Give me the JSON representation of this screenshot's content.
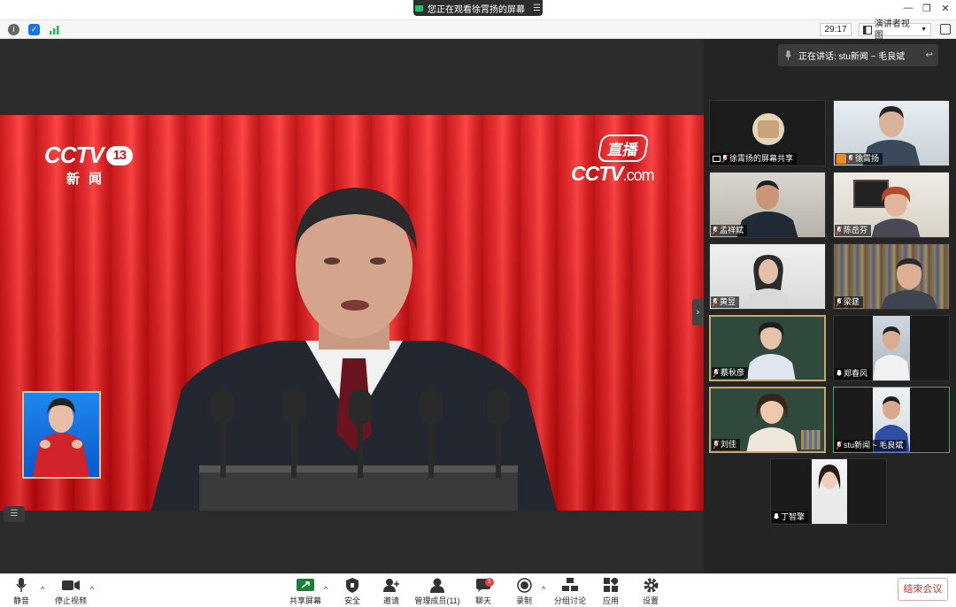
{
  "share_banner": {
    "text": "您正在观看徐霄扬的屏幕",
    "menu_icon": "menu-icon"
  },
  "toolbar": {
    "timer": "29:17",
    "view_label": "演讲者视图"
  },
  "video": {
    "channel_logo": "CCTV",
    "channel_number": "13",
    "channel_name": "新闻",
    "live_label": "直播",
    "live_logo": "CCTV",
    "live_logo_suffix": ".com"
  },
  "panel": {
    "talking_label": "正在讲话: stu新闻 ~ 毛良斌",
    "tiles": [
      {
        "name": "徐霄扬的屏幕共享"
      },
      {
        "name": "徐霄扬"
      },
      {
        "name": "孟祥斌"
      },
      {
        "name": "陈岳芬"
      },
      {
        "name": "黄昱"
      },
      {
        "name": "梁莛"
      },
      {
        "name": "蔡秋彦"
      },
      {
        "name": "郑春风"
      },
      {
        "name": "刘佳"
      },
      {
        "name": "stu新闻 ~ 毛良斌"
      },
      {
        "name": "丁智擎"
      }
    ]
  },
  "bottom": {
    "mute": "静音",
    "stop_video": "停止视频",
    "share_screen": "共享屏幕",
    "security": "安全",
    "invite": "邀请",
    "participants": "管理成员(11)",
    "chat": "聊天",
    "chat_badge": "1",
    "record": "录制",
    "breakout": "分组讨论",
    "apps": "应用",
    "settings": "设置",
    "end": "结束会议"
  },
  "colors": {
    "accent_green": "#2db45a",
    "end_red": "#d9302c",
    "curtain_red": "#e8262a"
  }
}
